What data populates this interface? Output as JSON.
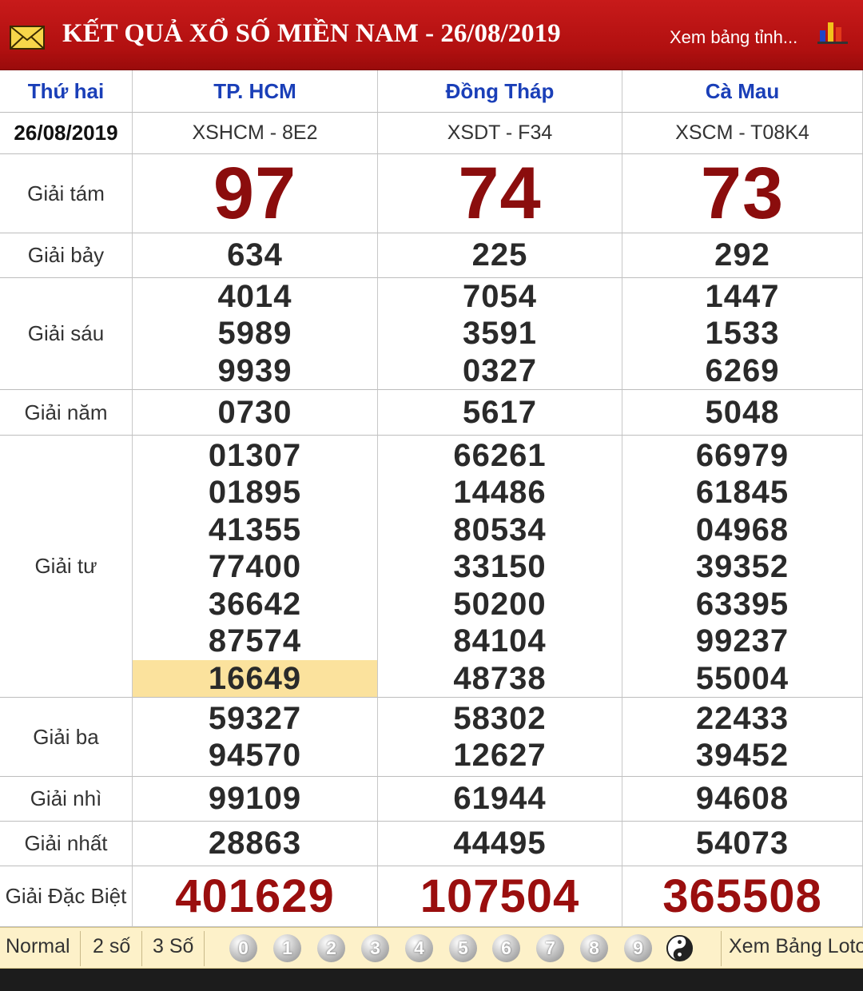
{
  "header": {
    "title": "KẾT QUẢ XỔ SỐ MIỀN NAM - 26/08/2019",
    "view_province": "Xem bảng tỉnh..."
  },
  "table": {
    "weekday": "Thứ hai",
    "date": "26/08/2019",
    "provinces": [
      {
        "name": "TP. HCM",
        "code": "XSHCM - 8E2"
      },
      {
        "name": "Đồng Tháp",
        "code": "XSDT - F34"
      },
      {
        "name": "Cà Mau",
        "code": "XSCM - T08K4"
      }
    ],
    "prizes": {
      "g8": {
        "label": "Giải tám",
        "values": [
          "97",
          "74",
          "73"
        ]
      },
      "g7": {
        "label": "Giải bảy",
        "values": [
          "634",
          "225",
          "292"
        ]
      },
      "g6": {
        "label": "Giải sáu",
        "values": [
          [
            "4014",
            "5989",
            "9939"
          ],
          [
            "7054",
            "3591",
            "0327"
          ],
          [
            "1447",
            "1533",
            "6269"
          ]
        ]
      },
      "g5": {
        "label": "Giải năm",
        "values": [
          "0730",
          "5617",
          "5048"
        ]
      },
      "g4": {
        "label": "Giải tư",
        "values": [
          [
            "01307",
            "01895",
            "41355",
            "77400",
            "36642",
            "87574",
            "16649"
          ],
          [
            "66261",
            "14486",
            "80534",
            "33150",
            "50200",
            "84104",
            "48738"
          ],
          [
            "66979",
            "61845",
            "04968",
            "39352",
            "63395",
            "99237",
            "55004"
          ]
        ]
      },
      "g3": {
        "label": "Giải ba",
        "values": [
          [
            "59327",
            "94570"
          ],
          [
            "58302",
            "12627"
          ],
          [
            "22433",
            "39452"
          ]
        ]
      },
      "g2": {
        "label": "Giải nhì",
        "values": [
          "99109",
          "61944",
          "94608"
        ]
      },
      "g1": {
        "label": "Giải nhất",
        "values": [
          "28863",
          "44495",
          "54073"
        ]
      },
      "special": {
        "label": "Giải Đặc Biệt",
        "values": [
          "401629",
          "107504",
          "365508"
        ]
      }
    }
  },
  "footer": {
    "modes": [
      "Normal",
      "2 số",
      "3 Số"
    ],
    "digits": [
      "0",
      "1",
      "2",
      "3",
      "4",
      "5",
      "6",
      "7",
      "8",
      "9"
    ],
    "view_loto": "Xem Bảng Loto"
  },
  "colors": {
    "header_red": "#b11010",
    "province_blue": "#1a3fb8",
    "prize_red": "#8b0d0d",
    "highlight": "#fbe29d",
    "footer_bg": "#fdf1c9"
  },
  "icons": [
    "mail-icon",
    "bar-chart-icon",
    "yin-yang-icon"
  ]
}
